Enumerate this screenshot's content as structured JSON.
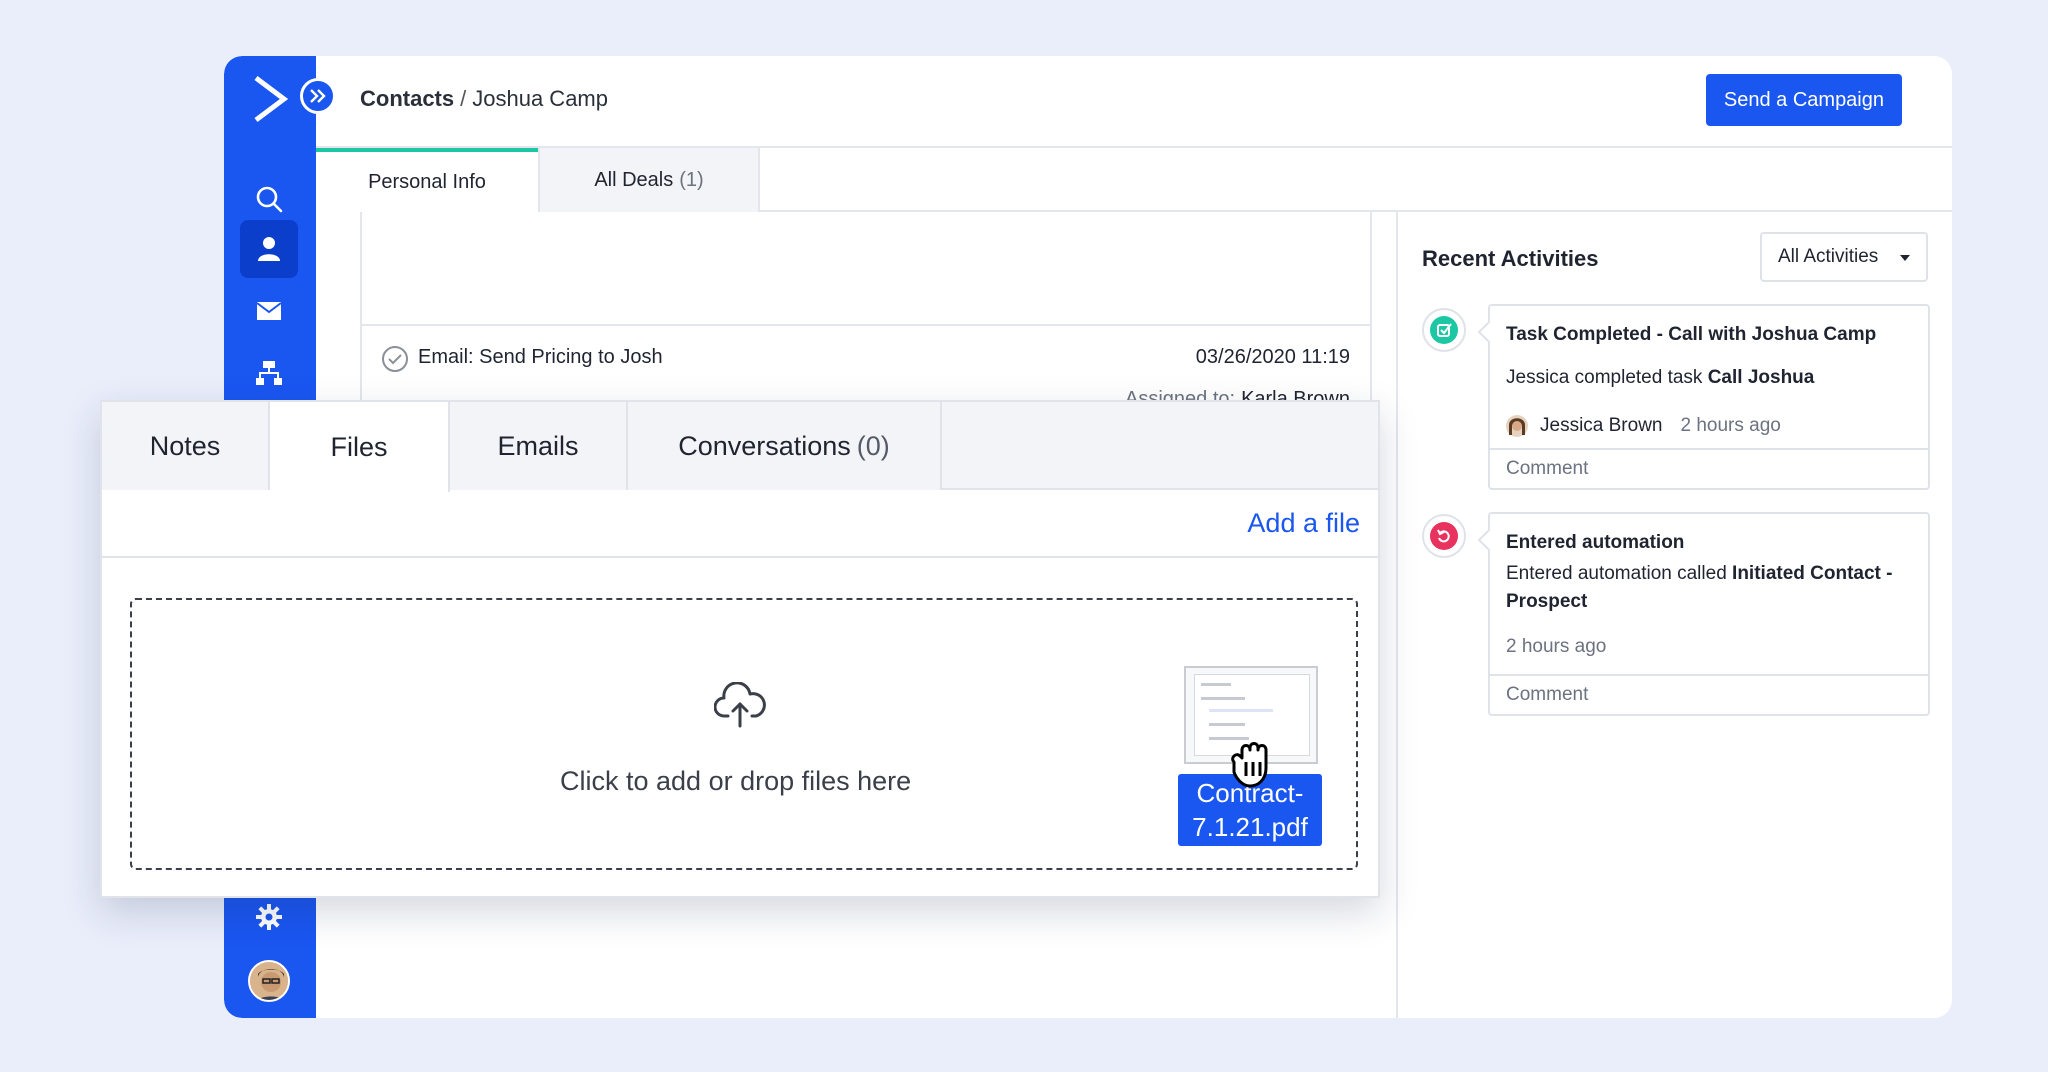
{
  "header": {
    "breadcrumb_root": "Contacts",
    "breadcrumb_separator": "/",
    "breadcrumb_current": "Joshua Camp",
    "send_campaign_label": "Send a Campaign"
  },
  "top_tabs": [
    {
      "label": "Personal Info",
      "count": ""
    },
    {
      "label": "All Deals",
      "count": "(1)"
    }
  ],
  "task": {
    "title": "Email: Send Pricing to Josh",
    "date": "03/26/2020 11:19",
    "assigned_label": "Assigned to:",
    "assigned_name": "Karla Brown"
  },
  "activities": {
    "title": "Recent Activities",
    "filter_value": "All Activities",
    "items": [
      {
        "heading": "Task Completed - Call with Joshua Camp",
        "body_prefix": "Jessica completed task",
        "body_bold": "Call Joshua",
        "user": "Jessica Brown",
        "time": "2 hours ago",
        "comment": "Comment"
      },
      {
        "heading": "Entered automation",
        "body_prefix": "Entered automation called",
        "body_bold": "Initiated Contact - Prospect",
        "time": "2 hours ago",
        "comment": "Comment"
      }
    ]
  },
  "files_panel": {
    "tabs": [
      {
        "label": "Notes",
        "count": ""
      },
      {
        "label": "Files",
        "count": ""
      },
      {
        "label": "Emails",
        "count": ""
      },
      {
        "label": "Conversations",
        "count": "(0)"
      }
    ],
    "add_file_label": "Add a file",
    "drop_text": "Click to add or drop files here",
    "dragged_file_name": "Contract-7.1.21.pdf"
  },
  "colors": {
    "brand_blue": "#1a56f0",
    "active_tab_accent": "#1ec7a3",
    "task_completed_icon": "#1ec7a3",
    "automation_icon": "#e8335f",
    "background": "#eaeefb"
  },
  "icons": {
    "logo": "activecampaign-chevron-logo",
    "expand": "double-chevron-right-icon",
    "search": "search-icon",
    "contacts": "person-icon",
    "email": "envelope-icon",
    "automations": "org-chart-icon",
    "settings": "gear-icon",
    "upload": "cloud-upload-icon",
    "drag": "grab-hand-icon"
  }
}
